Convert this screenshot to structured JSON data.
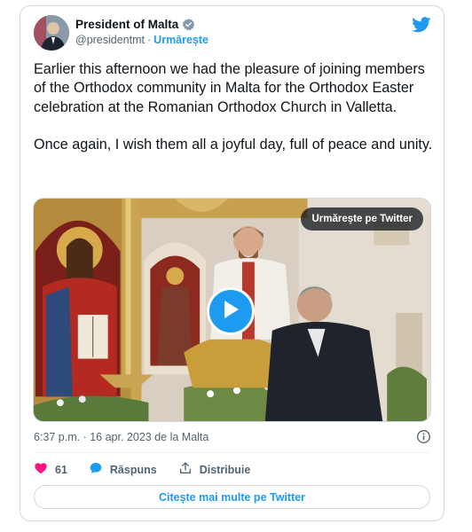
{
  "author": {
    "display_name": "President of Malta",
    "handle": "@presidentmt",
    "separator": "·",
    "follow_label": "Urmărește"
  },
  "tweet": {
    "paragraphs": [
      "Earlier this afternoon we had the pleasure of joining members of the Orthodox community in Malta for the Orthodox Easter celebration at the Romanian Orthodox Church in Valletta.",
      "Once again, I wish them all a joyful day, full of peace and unity."
    ]
  },
  "media": {
    "follow_on_twitter_label": "Urmărește pe Twitter",
    "type": "video"
  },
  "meta": {
    "timestamp": "6:37 p.m. · 16 apr. 2023 de la Malta"
  },
  "actions": {
    "like_count": "61",
    "reply_label": "Răspuns",
    "share_label": "Distribuie"
  },
  "read_more_label": "Citește mai multe pe Twitter",
  "icons": {
    "verified": "verified-badge-icon",
    "brand": "twitter-bird-icon",
    "info": "info-icon",
    "like": "heart-icon",
    "reply": "speech-bubble-icon",
    "share": "share-icon",
    "play": "play-icon"
  },
  "colors": {
    "accent": "#1d9bf0",
    "like": "#f91880",
    "text": "#0f1419",
    "muted": "#536471",
    "border": "#cfd9de"
  }
}
